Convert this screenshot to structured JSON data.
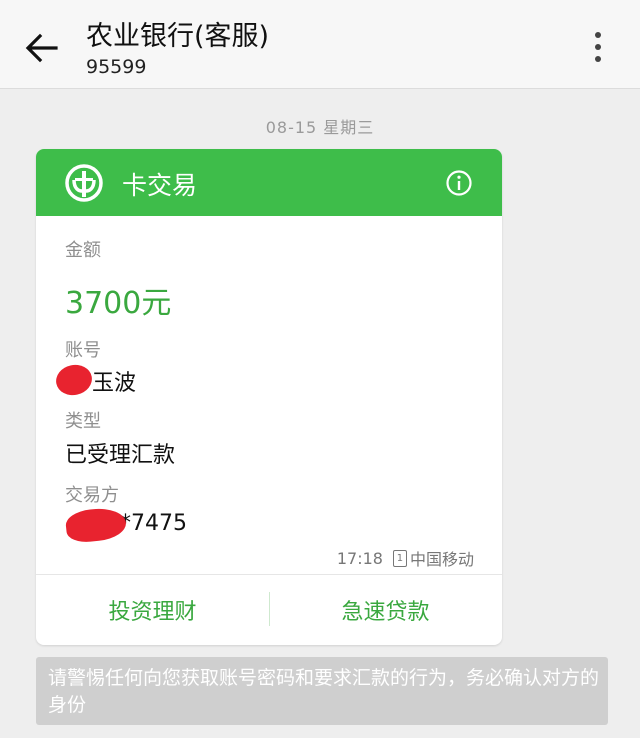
{
  "header": {
    "title": "农业银行(客服)",
    "number": "95599"
  },
  "timestamp": "08-15  星期三",
  "card": {
    "title": "卡交易",
    "amount_label": "金额",
    "amount_value": "3700元",
    "account_label": "账号",
    "account_value": "玉波",
    "type_label": "类型",
    "type_value": "已受理汇款",
    "counterparty_label": "交易方",
    "counterparty_value": "*7475",
    "time": "17:18",
    "sim_slot": "1",
    "carrier": "中国移动",
    "actions": [
      "投资理财",
      "急速贷款"
    ]
  },
  "warning": "请警惕任何向您获取账号密码和要求汇款的行为，务必确认对方的身份",
  "colors": {
    "accent_green": "#3ebd4a",
    "amount_green": "#3aa83f",
    "redaction_red": "#e8232f"
  },
  "icons": {
    "back": "arrow-left-icon",
    "more": "more-vertical-icon",
    "logo": "abc-bank-logo-icon",
    "info": "info-icon",
    "sim": "sim-1-icon"
  }
}
